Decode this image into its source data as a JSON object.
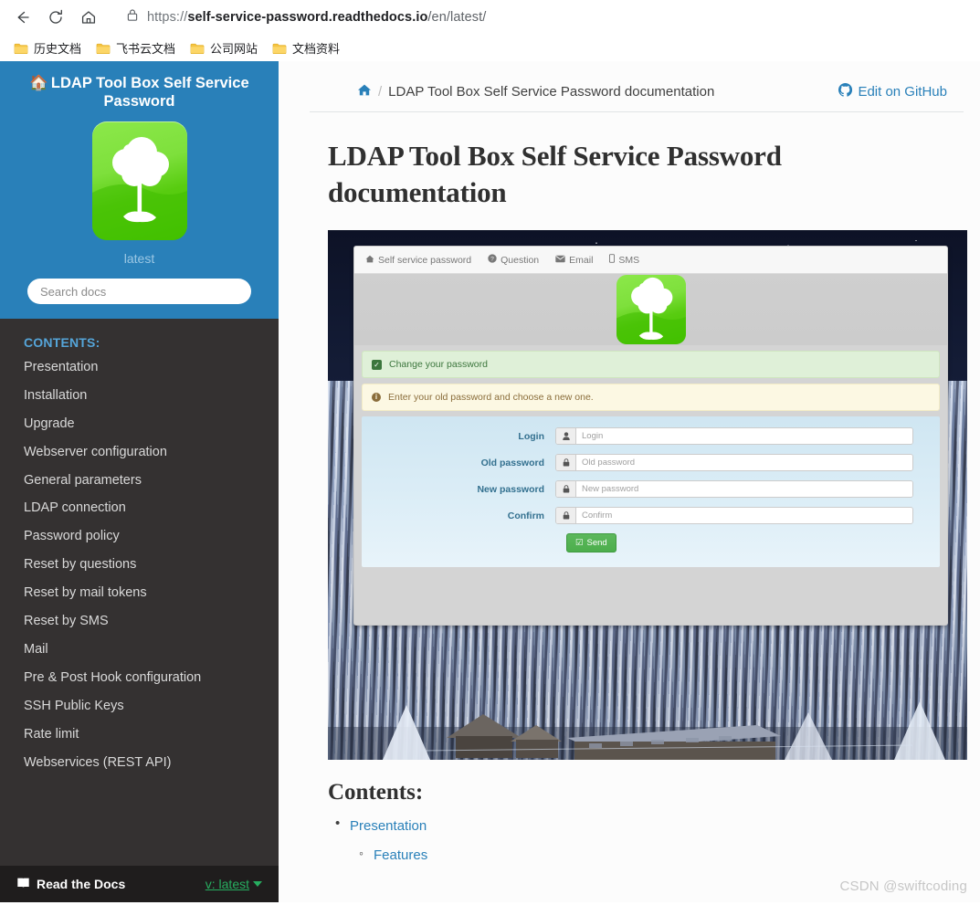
{
  "browser": {
    "back_icon": "back-arrow-icon",
    "reload_icon": "reload-icon",
    "home_icon": "home-icon",
    "lock_icon": "lock-icon",
    "url_scheme": "https://",
    "url_host": "self-service-password.readthedocs.io",
    "url_path": "/en/latest/",
    "url_full": "https://self-service-password.readthedocs.io/en/latest/",
    "bookmarks": [
      {
        "label": "历史文档",
        "icon": "folder-icon"
      },
      {
        "label": "飞书云文档",
        "icon": "folder-icon"
      },
      {
        "label": "公司网站",
        "icon": "folder-icon"
      },
      {
        "label": "文档资料",
        "icon": "folder-icon"
      }
    ]
  },
  "sidebar": {
    "brand": "LDAP Tool Box Self Service Password",
    "brand_icon": "home-icon",
    "logo_icon": "ldap-toolbox-tree-logo",
    "version_label": "latest",
    "search": {
      "placeholder": "Search docs",
      "value": ""
    },
    "nav_caption": "CONTENTS:",
    "nav_items": [
      {
        "label": "Presentation"
      },
      {
        "label": "Installation"
      },
      {
        "label": "Upgrade"
      },
      {
        "label": "Webserver configuration"
      },
      {
        "label": "General parameters"
      },
      {
        "label": "LDAP connection"
      },
      {
        "label": "Password policy"
      },
      {
        "label": "Reset by questions"
      },
      {
        "label": "Reset by mail tokens"
      },
      {
        "label": "Reset by SMS"
      },
      {
        "label": "Mail"
      },
      {
        "label": "Pre & Post Hook configuration"
      },
      {
        "label": "SSH Public Keys"
      },
      {
        "label": "Rate limit"
      },
      {
        "label": "Webservices (REST API)"
      }
    ],
    "footer": {
      "brand": "Read the Docs",
      "brand_icon": "book-icon",
      "version": "v: latest",
      "caret_icon": "caret-down-icon"
    }
  },
  "content": {
    "breadcrumb": {
      "home_icon": "home-icon",
      "separator": "/",
      "current": "LDAP Tool Box Self Service Password documentation"
    },
    "github_link": {
      "label": "Edit on GitHub",
      "icon": "github-icon"
    },
    "page_title": "LDAP Tool Box Self Service Password documentation",
    "screenshot": {
      "nav_items": [
        {
          "label": "Self service password",
          "icon": "home-icon"
        },
        {
          "label": "Question",
          "icon": "question-circle-icon"
        },
        {
          "label": "Email",
          "icon": "envelope-icon"
        },
        {
          "label": "SMS",
          "icon": "mobile-icon"
        }
      ],
      "logo_icon": "ldap-toolbox-tree-logo",
      "success_alert": {
        "text": "Change your password",
        "icon": "check-square-icon"
      },
      "info_alert": {
        "text": "Enter your old password and choose a new one.",
        "icon": "info-circle-icon"
      },
      "form_fields": [
        {
          "label": "Login",
          "placeholder": "Login",
          "value": "",
          "addon_icon": "user-icon"
        },
        {
          "label": "Old password",
          "placeholder": "Old password",
          "value": "",
          "addon_icon": "lock-icon"
        },
        {
          "label": "New password",
          "placeholder": "New password",
          "value": "",
          "addon_icon": "lock-icon"
        },
        {
          "label": "Confirm",
          "placeholder": "Confirm",
          "value": "",
          "addon_icon": "lock-icon"
        }
      ],
      "submit": {
        "label": "Send",
        "icon": "check-square-icon",
        "color": "#5cb85c"
      }
    },
    "contents_heading": "Contents:",
    "toc": [
      {
        "label": "Presentation",
        "children": [
          {
            "label": "Features"
          }
        ]
      }
    ]
  },
  "watermark": "CSDN @swiftcoding",
  "colors": {
    "sidebar_header": "#2980B9",
    "sidebar_body": "#343131",
    "sidebar_footer": "#1f1d1d",
    "link": "#2980B9",
    "nav_caption": "#55a5d9",
    "rtd_version": "#27AE60",
    "logo_green": "#58cc10",
    "success": "#dff0d8",
    "warning": "#fcf8e3"
  }
}
